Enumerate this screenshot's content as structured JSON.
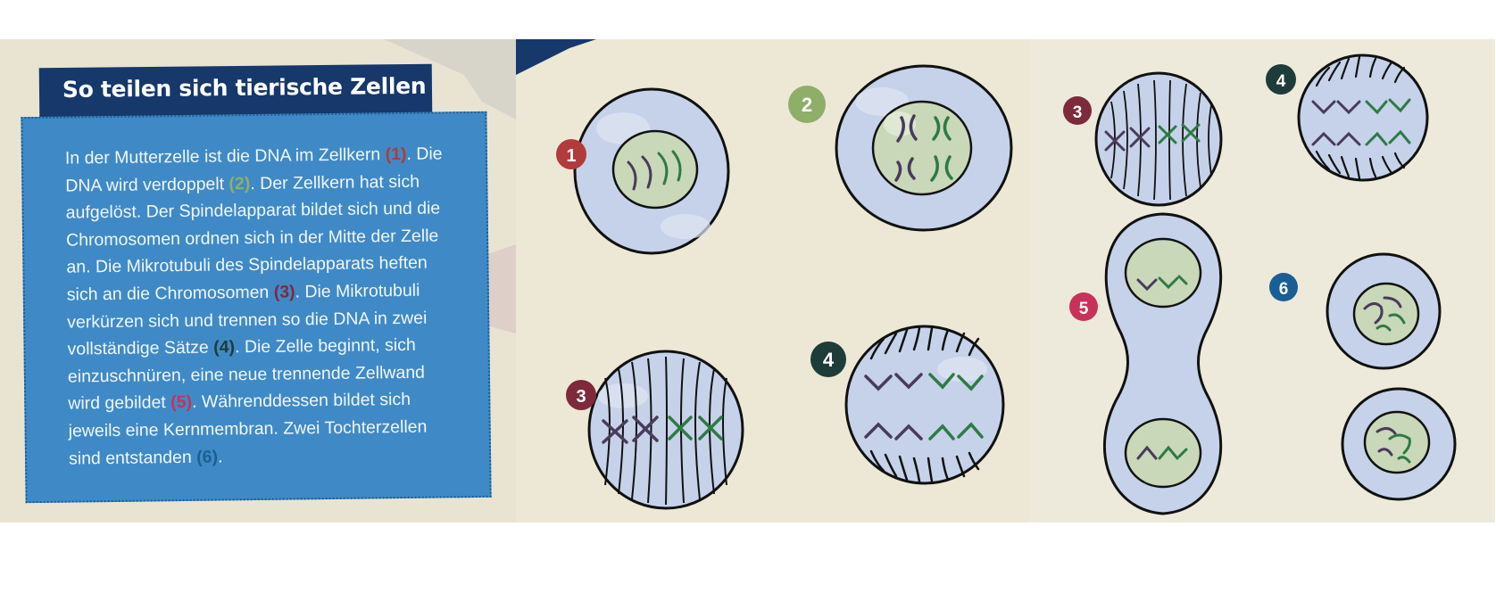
{
  "title": "So teilen sich tierische Zellen",
  "description": {
    "s1": "In der Mutterzelle ist die DNA im Zellkern ",
    "n1": "(1)",
    "s2": ". Die DNA wird verdoppelt ",
    "n2": "(2)",
    "s3": ". Der Zellkern hat sich aufgelöst. Der Spindelapparat bildet sich und die Chromosomen ordnen sich in der Mitte der Zelle an. Die Mikrotubuli des Spindelapparats heften sich an die Chromosomen ",
    "n3": "(3)",
    "s4": ". Die Mikrotubuli verkürzen sich und trennen so die DNA in zwei vollständige Sätze ",
    "n4": "(4)",
    "s5": ". Die Zelle beginnt, sich einzuschnüren, eine neue trennende Zellwand wird gebildet ",
    "n5": "(5)",
    "s6": ". Währenddessen bildet sich jeweils eine Kernmembran. Zwei Tochterzellen sind entstanden ",
    "n6": "(6)",
    "s7": "."
  },
  "badges": {
    "b1": "1",
    "b2": "2",
    "b3": "3",
    "b4": "4",
    "b3b": "3",
    "b4b": "4",
    "b5": "5",
    "b6": "6"
  },
  "colors": {
    "title_bar": "#16386b",
    "text_box": "#3f8ac6",
    "cell_fill": "#c5d2ea",
    "nucleus_fill": "#c9d8b8",
    "badge_1": "#b13a3a",
    "badge_2": "#8fae6a",
    "badge_3": "#7d2a3b",
    "badge_4": "#1e3c3a",
    "badge_5": "#c8315a",
    "badge_6": "#1a5f93",
    "chromosome_dark": "#4a3a5c",
    "chromosome_green": "#2e7a44"
  }
}
